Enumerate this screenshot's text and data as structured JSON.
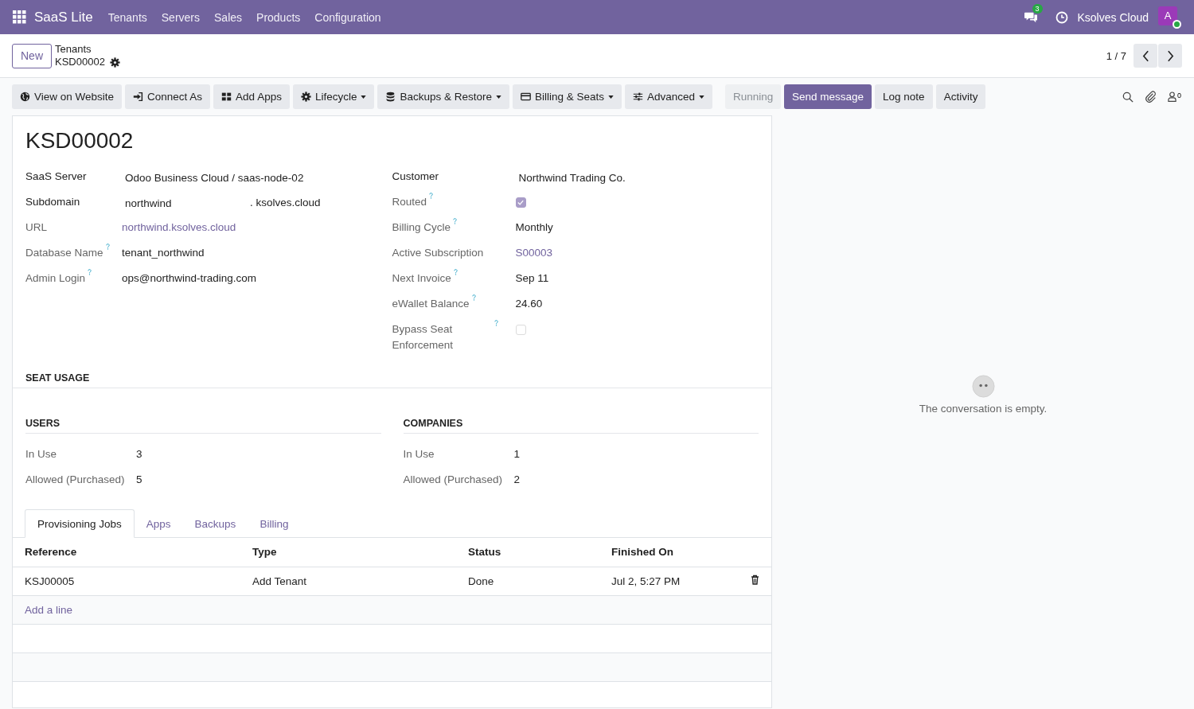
{
  "navbar": {
    "app_name": "SaaS Lite",
    "menu": [
      "Tenants",
      "Servers",
      "Sales",
      "Products",
      "Configuration"
    ],
    "messages_badge": "3",
    "company": "Ksolves Cloud",
    "avatar": "A",
    "online": true
  },
  "control_panel": {
    "new_button": "New",
    "breadcrumb_parent": "Tenants",
    "breadcrumb_current": "KSD00002",
    "pager": "1 / 7"
  },
  "actions": [
    {
      "label": "View on Website",
      "dropdown": false
    },
    {
      "label": "Connect As",
      "dropdown": false
    },
    {
      "label": "Add Apps",
      "dropdown": false
    },
    {
      "label": "Lifecycle",
      "dropdown": true
    },
    {
      "label": "Backups & Restore",
      "dropdown": true
    },
    {
      "label": "Billing & Seats",
      "dropdown": true
    },
    {
      "label": "Advanced",
      "dropdown": true
    }
  ],
  "status": "Running",
  "chatter": {
    "buttons": [
      {
        "label": "Send message",
        "primary": true
      },
      {
        "label": "Log note",
        "primary": false
      },
      {
        "label": "Activity",
        "primary": false
      }
    ],
    "followers": "0",
    "empty_message": "The conversation is empty."
  },
  "form": {
    "title": "KSD00002",
    "left_fields": [
      {
        "label": "SaaS Server",
        "kind": "text",
        "value": "Odoo Business Cloud / saas-node-02",
        "required": true,
        "help": false
      },
      {
        "label": "Subdomain",
        "kind": "subdomain",
        "value": "northwind",
        "suffix": ". ksolves.cloud",
        "required": true,
        "help": false
      },
      {
        "label": "URL",
        "kind": "link",
        "value": "northwind.ksolves.cloud",
        "required": false,
        "help": false
      },
      {
        "label": "Database Name",
        "kind": "text",
        "value": "tenant_northwind",
        "required": false,
        "help": true
      },
      {
        "label": "Admin Login",
        "kind": "text",
        "value": "ops@northwind-trading.com",
        "required": false,
        "help": true
      }
    ],
    "right_fields": [
      {
        "label": "Customer",
        "kind": "text",
        "value": "Northwind Trading Co.",
        "required": true,
        "help": false
      },
      {
        "label": "Routed",
        "kind": "checkbox",
        "checked": true,
        "required": false,
        "help": true
      },
      {
        "label": "Billing Cycle",
        "kind": "text",
        "value": "Monthly",
        "required": false,
        "help": true
      },
      {
        "label": "Active Subscription",
        "kind": "link",
        "value": "S00003",
        "required": false,
        "help": false
      },
      {
        "label": "Next Invoice",
        "kind": "text",
        "value": "Sep 11",
        "required": false,
        "help": true
      },
      {
        "label": "eWallet Balance",
        "kind": "text",
        "value": "24.60",
        "required": false,
        "help": true
      },
      {
        "label": "Bypass Seat Enforcement",
        "kind": "checkbox",
        "checked": false,
        "required": false,
        "help": true
      }
    ]
  },
  "seat_usage": {
    "title": "SEAT USAGE",
    "groups": [
      {
        "title": "USERS",
        "rows": [
          {
            "label": "In Use",
            "value": "3"
          },
          {
            "label": "Allowed (Purchased)",
            "value": "5"
          }
        ]
      },
      {
        "title": "COMPANIES",
        "rows": [
          {
            "label": "In Use",
            "value": "1"
          },
          {
            "label": "Allowed (Purchased)",
            "value": "2"
          }
        ]
      }
    ]
  },
  "tabs": [
    {
      "label": "Provisioning Jobs",
      "selected": true
    },
    {
      "label": "Apps",
      "selected": false
    },
    {
      "label": "Backups",
      "selected": false
    },
    {
      "label": "Billing",
      "selected": false
    }
  ],
  "table": {
    "columns": [
      "Reference",
      "Type",
      "Status",
      "Finished On"
    ],
    "rows": [
      [
        "KSJ00005",
        "Add Tenant",
        "Done",
        "Jul 2, 5:27 PM"
      ]
    ],
    "add_line": "Add a line"
  }
}
